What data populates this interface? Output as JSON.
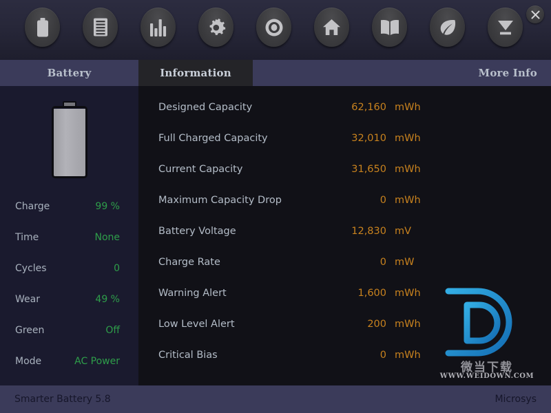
{
  "toolbar": {
    "buttons": [
      {
        "name": "battery-icon",
        "label": "Battery"
      },
      {
        "name": "list-icon",
        "label": "Log"
      },
      {
        "name": "bar-chart-icon",
        "label": "Graphs"
      },
      {
        "name": "gear-icon",
        "label": "Options"
      },
      {
        "name": "target-icon",
        "label": "Calibrate"
      },
      {
        "name": "home-icon",
        "label": "Home"
      },
      {
        "name": "book-icon",
        "label": "Help"
      },
      {
        "name": "leaf-icon",
        "label": "Green Mode"
      },
      {
        "name": "download-icon",
        "label": "Download"
      }
    ],
    "close_label": "×"
  },
  "tabs": [
    {
      "id": "battery",
      "label": "Battery",
      "active": false
    },
    {
      "id": "information",
      "label": "Information",
      "active": true
    },
    {
      "id": "more-info",
      "label": "More Info",
      "active": false
    }
  ],
  "sidebar": {
    "battery": {
      "charge_percent": 99,
      "fill_color": "#b2b2b8"
    },
    "stats": [
      {
        "label": "Charge",
        "value": "99 %"
      },
      {
        "label": "Time",
        "value": "None"
      },
      {
        "label": "Cycles",
        "value": "0"
      },
      {
        "label": "Wear",
        "value": "49 %"
      },
      {
        "label": "Green",
        "value": "Off"
      },
      {
        "label": "Mode",
        "value": "AC Power"
      }
    ]
  },
  "information": {
    "rows": [
      {
        "label": "Designed Capacity",
        "value": "62,160",
        "unit": "mWh"
      },
      {
        "label": "Full Charged Capacity",
        "value": "32,010",
        "unit": "mWh"
      },
      {
        "label": "Current Capacity",
        "value": "31,650",
        "unit": "mWh"
      },
      {
        "label": "Maximum Capacity Drop",
        "value": "0",
        "unit": "mWh"
      },
      {
        "label": "Battery Voltage",
        "value": "12,830",
        "unit": "mV"
      },
      {
        "label": "Charge Rate",
        "value": "0",
        "unit": "mW"
      },
      {
        "label": "Warning Alert",
        "value": "1,600",
        "unit": "mWh"
      },
      {
        "label": "Low Level Alert",
        "value": "200",
        "unit": "mWh"
      },
      {
        "label": "Critical Bias",
        "value": "0",
        "unit": "mWh"
      }
    ]
  },
  "watermark": {
    "cn_text": "微当下载",
    "url_text": "WWW.WEIDOWN.COM",
    "logo_color": "#2196d8"
  },
  "statusbar": {
    "left": "Smarter Battery 5.8",
    "right": "Microsys"
  },
  "colors": {
    "accent_orange": "#c8821e",
    "accent_green": "#2e9e4a",
    "tabbar_bg": "#3b3b5a",
    "sidebar_bg": "#1a1a2e",
    "main_bg": "#111117"
  }
}
